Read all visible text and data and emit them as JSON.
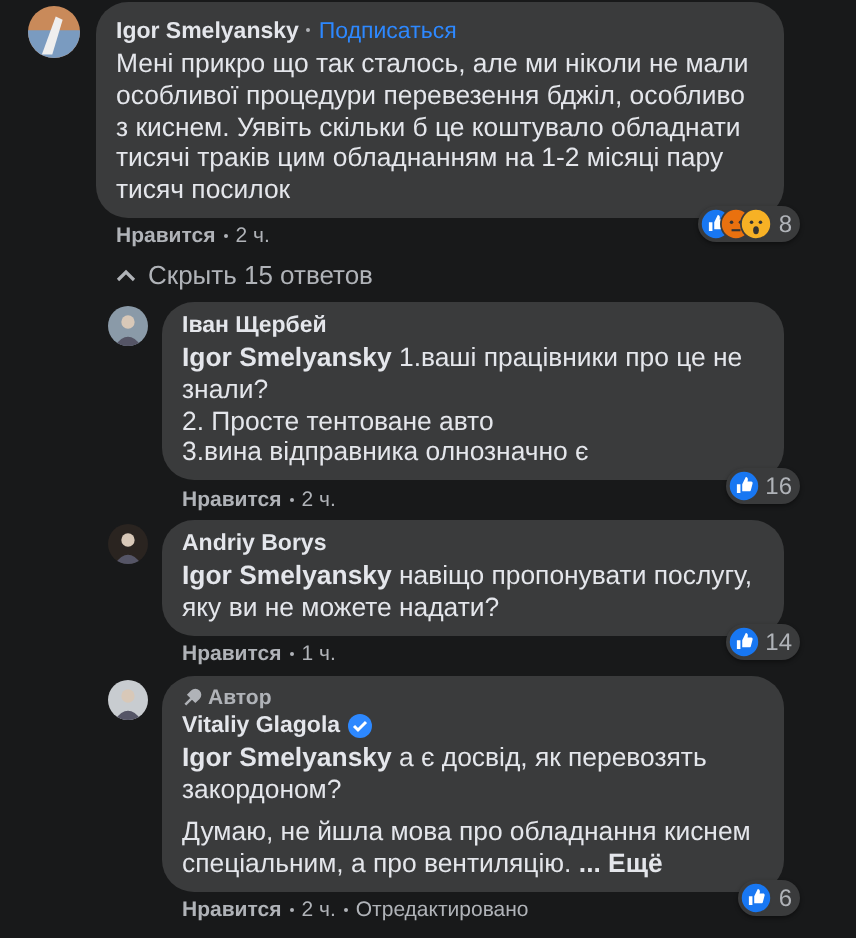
{
  "comment": {
    "author": "Igor Smelyansky",
    "follow": "Подписаться",
    "paragraphs": [
      "Мені прикро що так сталось, але ми ніколи не мали особливої процедури перевезення бджіл, особливо з киснем. Уявіть скільки б це коштувало обладнати тисячі траків цим обладнанням на 1-2 місяці пару тисяч посилок"
    ],
    "reactions": {
      "icons": [
        {
          "kind": "like"
        },
        {
          "kind": "angry"
        },
        {
          "kind": "wow"
        }
      ],
      "count": "8"
    },
    "like": "Нравится",
    "time": "2 ч."
  },
  "toggle": {
    "label": "Скрыть 15 ответов",
    "expanded": true
  },
  "replies": [
    {
      "author": "Іван Щербей",
      "author_badge": false,
      "verified": false,
      "paragraphs": [
        "**Igor Smelyansky** 1.ваші працівники про це не знали?\n2. Просте тентоване авто\n3.вина відправника олнозначно є"
      ],
      "reactions": {
        "icons": [
          {
            "kind": "like"
          }
        ],
        "count": "16"
      },
      "like": "Нравится",
      "time": "2 ч."
    },
    {
      "author": "Andriy Borys",
      "author_badge": false,
      "verified": false,
      "paragraphs": [
        "**Igor Smelyansky** навіщо пропонувати послугу, яку ви не можете надати?"
      ],
      "reactions": {
        "icons": [
          {
            "kind": "like"
          }
        ],
        "count": "14"
      },
      "like": "Нравится",
      "time": "1 ч."
    },
    {
      "author": "Vitaliy Glagola",
      "badge": "Автор",
      "author_badge": true,
      "verified": true,
      "paragraphs": [
        "**Igor Smelyansky** а є досвід, як перевозять закордоном?",
        "Думаю, не йшла мова про обладнання киснем спеціальним, а про вентиляцію."
      ],
      "more": "... Ещё",
      "reactions": {
        "icons": [
          {
            "kind": "like"
          }
        ],
        "count": "6"
      },
      "like": "Нравится",
      "time": "2 ч.",
      "edited": "Отредактировано"
    }
  ]
}
